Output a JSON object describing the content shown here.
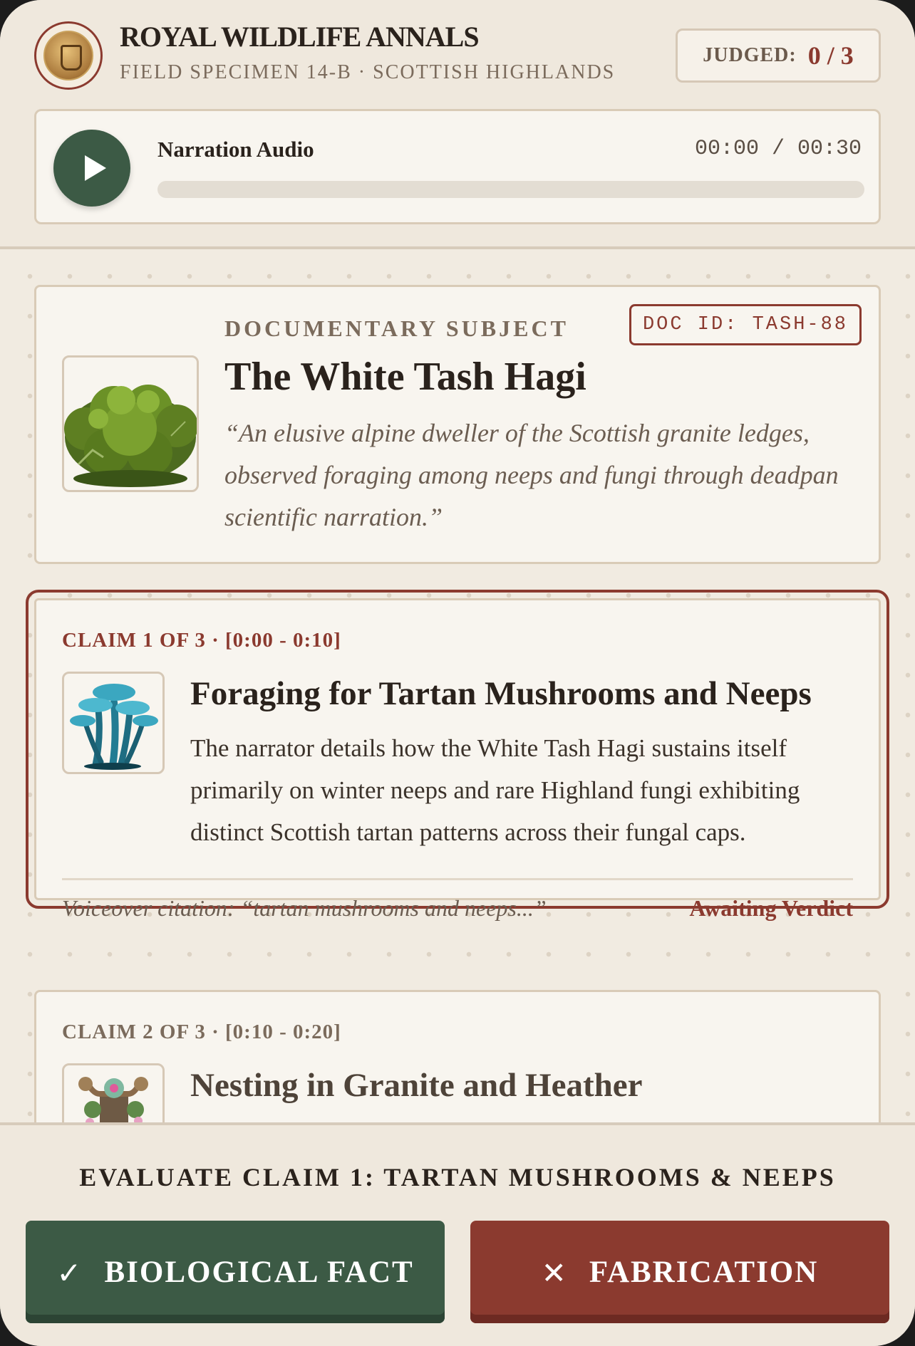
{
  "header": {
    "title": "ROYAL WILDLIFE ANNALS",
    "subtitle": "FIELD SPECIMEN 14-B · SCOTTISH HIGHLANDS",
    "judged_label": "JUDGED:",
    "judged_value": "0 / 3"
  },
  "player": {
    "label": "Narration Audio",
    "time": "00:00 / 00:30",
    "progress": 0
  },
  "subject": {
    "kicker": "DOCUMENTARY SUBJECT",
    "doc_id": "DOC ID: TASH-88",
    "name": "The White Tash Hagi",
    "quote": "“An elusive alpine dweller of the Scottish granite ledges, observed foraging among neeps and fungi through deadpan scientific narration.”"
  },
  "claims": [
    {
      "meta": "CLAIM 1 OF 3 · [0:00 - 0:10]",
      "title": "Foraging for Tartan Mushrooms and Neeps",
      "body": "The narrator details how the White Tash Hagi sustains itself primarily on winter neeps and rare Highland fungi exhibiting distinct Scottish tartan patterns across their fungal caps.",
      "citation": "Voiceover citation: “tartan mushrooms and neeps...”",
      "status": "Awaiting Verdict"
    },
    {
      "meta": "CLAIM 2 OF 3 · [0:10 - 0:20]",
      "title": "Nesting in Granite and Heather"
    }
  ],
  "footer": {
    "evaluate_label": "EVALUATE CLAIM 1: TARTAN MUSHROOMS & NEEPS",
    "fact_label": "BIOLOGICAL FACT",
    "fabrication_label": "FABRICATION",
    "fact_icon": "checkmark-icon",
    "fabrication_icon": "cross-icon"
  },
  "colors": {
    "accent_red": "#8b3a2f",
    "accent_green": "#3c5a45",
    "paper": "#f8f5ef",
    "background": "#f1ebe1"
  }
}
